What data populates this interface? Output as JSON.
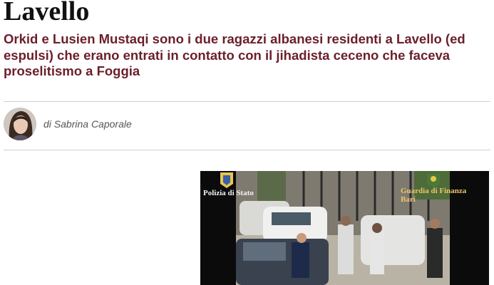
{
  "article": {
    "headline_tail": "Lavello",
    "subtitle": "Orkid e Lusien Mustaqi sono i due ragazzi albanesi residenti a Lavello (ed espulsi) che erano entrati in contatto con il jihadista ceceno che faceva proselitismo a Foggia",
    "byline_prefix": "di",
    "author": "Sabrina Caporale"
  },
  "video": {
    "watermark_left": "Polizia di Stato",
    "watermark_right_line1": "Guardia di Finanza",
    "watermark_right_line2": "Bari"
  }
}
